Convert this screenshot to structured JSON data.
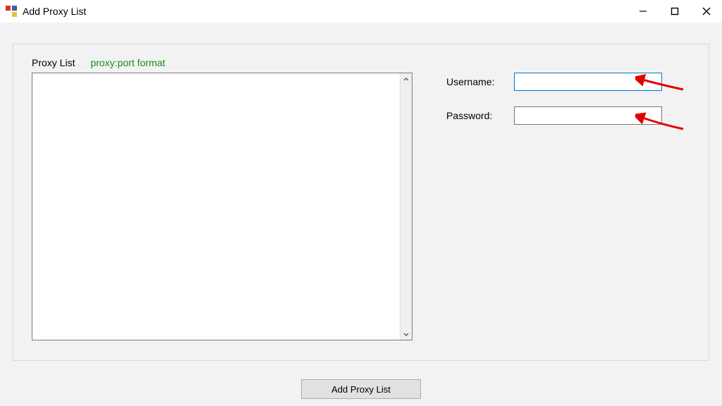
{
  "window": {
    "title": "Add Proxy List"
  },
  "panel": {
    "proxy_list_label": "Proxy List",
    "proxy_list_hint": "proxy:port format",
    "proxy_list_value": ""
  },
  "credentials": {
    "username_label": "Username:",
    "username_value": "",
    "password_label": "Password:",
    "password_value": ""
  },
  "buttons": {
    "add_proxy_list": "Add Proxy List"
  },
  "annotations": {
    "arrow_color": "#e30000"
  }
}
